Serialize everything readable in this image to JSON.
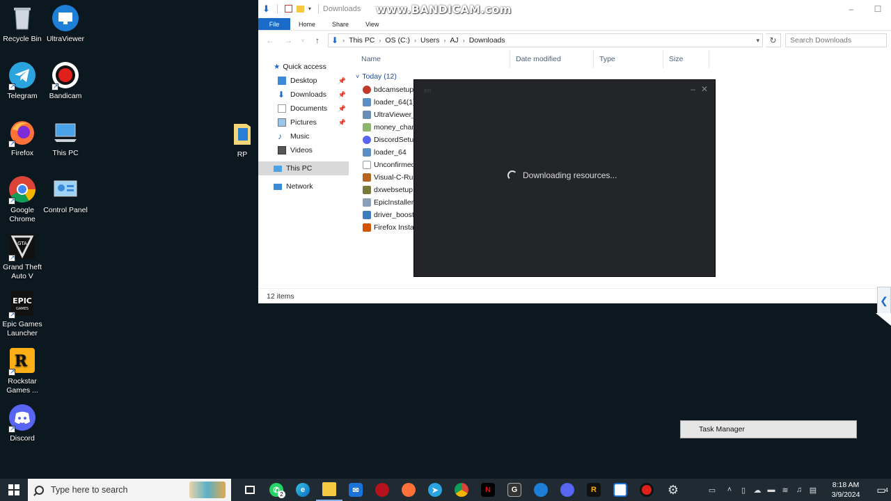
{
  "watermark": "www.BANDICAM.com",
  "desktop_icons": [
    {
      "label": "Recycle Bin"
    },
    {
      "label": "UltraViewer"
    },
    {
      "label": "Telegram"
    },
    {
      "label": "Bandicam"
    },
    {
      "label": "Firefox"
    },
    {
      "label": "This PC"
    },
    {
      "label": "Google Chrome"
    },
    {
      "label": "Control Panel"
    },
    {
      "label": "Grand Theft Auto V"
    },
    {
      "label": "Epic Games Launcher"
    },
    {
      "label": "Rockstar Games ..."
    },
    {
      "label": "Discord"
    },
    {
      "label": "RP"
    }
  ],
  "explorer": {
    "title": "Downloads",
    "ribbon_tabs": [
      "File",
      "Home",
      "Share",
      "View"
    ],
    "breadcrumb": [
      "This PC",
      "OS (C:)",
      "Users",
      "AJ",
      "Downloads"
    ],
    "search_placeholder": "Search Downloads",
    "nav": {
      "quick_access": "Quick access",
      "items": [
        "Desktop",
        "Downloads",
        "Documents",
        "Pictures",
        "Music",
        "Videos"
      ],
      "this_pc": "This PC",
      "network": "Network"
    },
    "columns": [
      "Name",
      "Date modified",
      "Type",
      "Size"
    ],
    "group": "Today (12)",
    "files": [
      "bdcamsetup",
      "loader_64(1)",
      "UltraViewer_s",
      "money_chang",
      "DiscordSetup",
      "loader_64",
      "Unconfirmed",
      "Visual-C-Runt",
      "dxwebsetup",
      "EpicInstaller-",
      "driver_booste",
      "Firefox Install"
    ],
    "status": "12 items"
  },
  "loader": {
    "lang": "en",
    "message": "Downloading resources..."
  },
  "task_manager": "Task Manager",
  "taskbar": {
    "search_placeholder": "Type here to search",
    "whatsapp_badge": "2",
    "time": "8:18 AM",
    "date": "3/9/2024",
    "notification_count": "4"
  },
  "colors": {
    "desktop_bg": "#0c1820",
    "accent": "#1a6ac7",
    "taskbar": "#1f2a33"
  }
}
